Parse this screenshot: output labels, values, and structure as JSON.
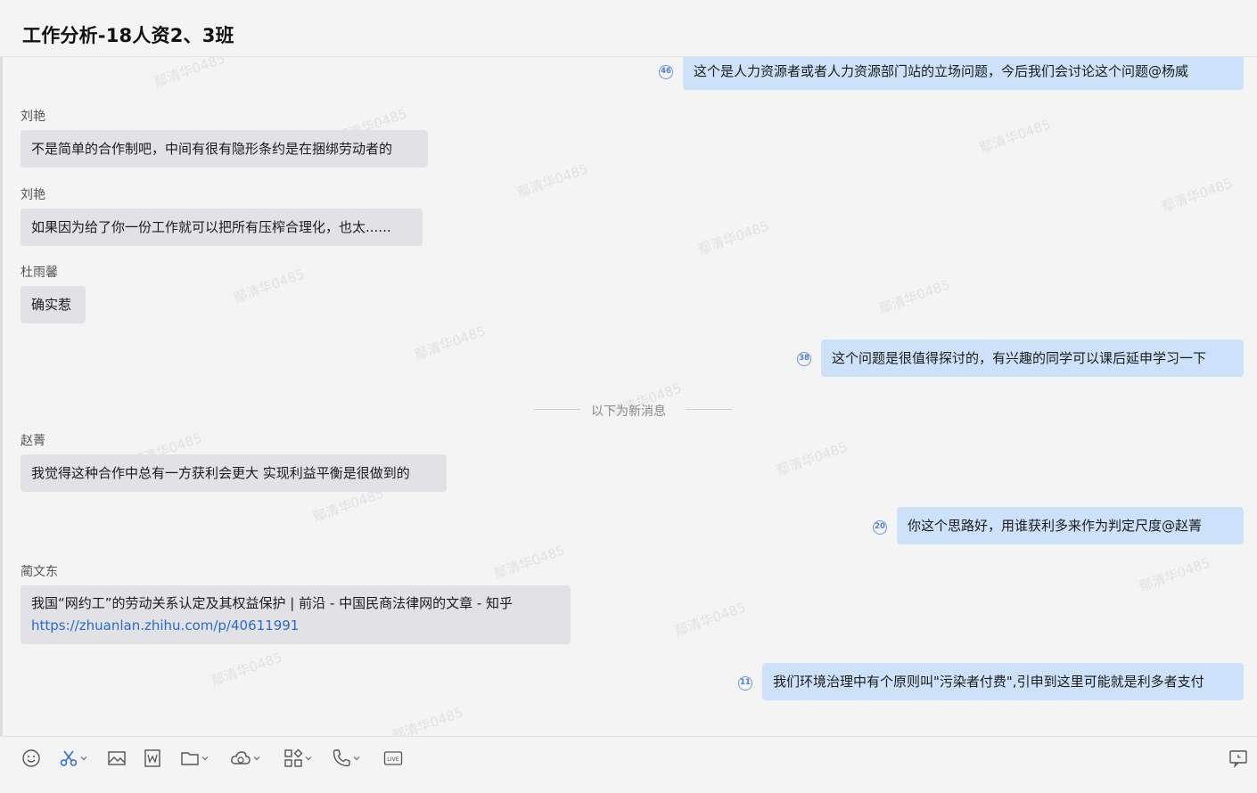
{
  "header": {
    "title": "工作分析-18人资2、3班"
  },
  "watermark": "鄢清华0485",
  "divider_text": "以下为新消息",
  "messages": [
    {
      "side": "out",
      "text": "这个是人力资源者或者人力资源部门站的立场问题，今后我们会讨论这个问题@杨威",
      "read": "46"
    },
    {
      "side": "in",
      "sender": "刘艳",
      "text": "不是简单的合作制吧，中间有很有隐形条约是在捆绑劳动者的"
    },
    {
      "side": "in",
      "sender": "刘艳",
      "text": "如果因为给了你一份工作就可以把所有压榨合理化，也太......"
    },
    {
      "side": "in",
      "sender": "杜雨馨",
      "text": "确实惹"
    },
    {
      "side": "out",
      "text": "这个问题是很值得探讨的，有兴趣的同学可以课后延申学习一下",
      "read": "38"
    },
    {
      "side": "in",
      "sender": "赵菁",
      "text": "我觉得这种合作中总有一方获利会更大 实现利益平衡是很做到的"
    },
    {
      "side": "out",
      "text": "你这个思路好，用谁获利多来作为判定尺度@赵菁",
      "read": "20"
    },
    {
      "side": "in",
      "sender": "蔺文东",
      "text": "我国“网约工”的劳动关系认定及其权益保护 | 前沿 - 中国民商法律网的文章 - 知乎",
      "link": "https://zhuanlan.zhihu.com/p/40611991"
    },
    {
      "side": "out",
      "text": "我们环境治理中有个原则叫\"污染者付费\",引申到这里可能就是利多者支付",
      "read": "11"
    }
  ],
  "toolbar": {
    "icons": [
      "emoji-icon",
      "scissors-icon",
      "image-icon",
      "word-doc-icon",
      "folder-icon",
      "cloud-icon",
      "apps-icon",
      "phone-icon",
      "live-icon",
      "screen-share-icon"
    ],
    "live_label": "LIVE"
  }
}
